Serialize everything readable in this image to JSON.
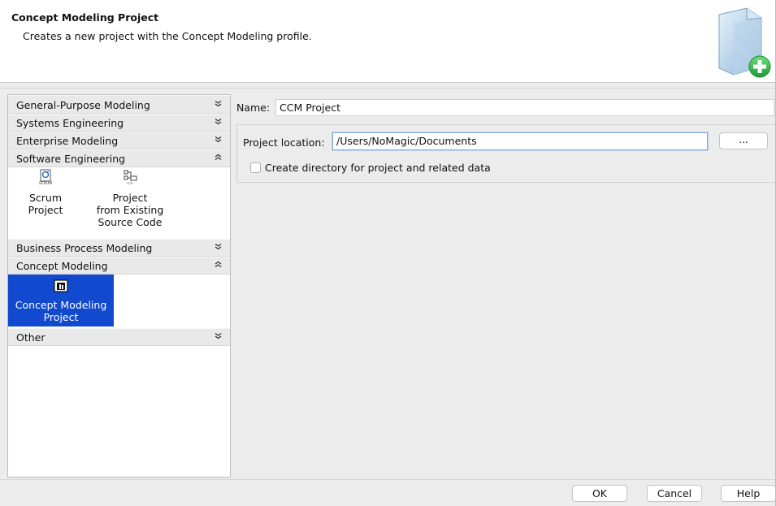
{
  "header": {
    "title": "Concept Modeling Project",
    "description": "Creates a new project with the Concept Modeling profile.",
    "icon": "new-project-plus-icon"
  },
  "categories": [
    {
      "label": "General-Purpose Modeling",
      "state": "collapsed"
    },
    {
      "label": "Systems Engineering",
      "state": "collapsed"
    },
    {
      "label": "Enterprise Modeling",
      "state": "collapsed"
    },
    {
      "label": "Software Engineering",
      "state": "expanded",
      "items": [
        {
          "label": "Scrum\nProject",
          "icon": "scrum-icon"
        },
        {
          "label": "Project\nfrom Existing\nSource Code",
          "icon": "source-code-project-icon"
        }
      ]
    },
    {
      "label": "Business Process Modeling",
      "state": "collapsed"
    },
    {
      "label": "Concept Modeling",
      "state": "expanded",
      "items": [
        {
          "label": "Concept Modeling\nProject",
          "icon": "concept-modeling-icon",
          "selected": true
        }
      ]
    },
    {
      "label": "Other",
      "state": "collapsed"
    }
  ],
  "chevrons": {
    "collapsed": "»",
    "expanded": "«"
  },
  "form": {
    "name_label": "Name:",
    "name_value": "CCM Project",
    "location_label": "Project location:",
    "location_value": "/Users/NoMagic/Documents",
    "browse_label": "...",
    "create_dir_label": "Create directory for project and related data",
    "create_dir_checked": false
  },
  "buttons": {
    "ok": "OK",
    "cancel": "Cancel",
    "help": "Help"
  },
  "colors": {
    "selection": "#1149cf",
    "header_icon_green": "#2fb84a"
  }
}
